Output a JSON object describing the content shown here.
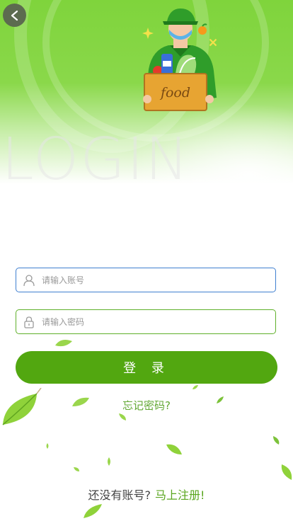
{
  "header": {
    "bg_text": "LOGIN",
    "back_icon": "chevron-left-icon",
    "illustration_sign": "food"
  },
  "form": {
    "username_placeholder": "请输入账号",
    "username_icon": "user-icon",
    "password_placeholder": "请输入密码",
    "password_icon": "lock-icon",
    "login_label": "登 录",
    "forgot_label": "忘记密码?"
  },
  "footer": {
    "question": "还没有账号?",
    "register_link": "马上注册!"
  },
  "colors": {
    "primary_green": "#52a710",
    "link_green": "#5aa61f",
    "focus_blue": "#3f7fd0"
  }
}
